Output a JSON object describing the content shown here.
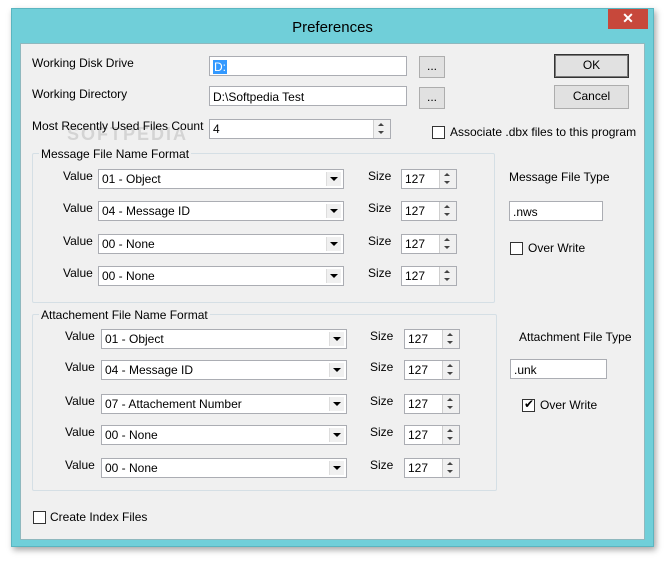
{
  "window": {
    "title": "Preferences",
    "close_glyph": "✕"
  },
  "top": {
    "working_disk_drive_label": "Working Disk Drive",
    "working_disk_drive_value": "D:",
    "working_directory_label": "Working Directory",
    "working_directory_value": "D:\\Softpedia Test",
    "browse_label": "...",
    "mru_label": "Most Recently Used Files Count",
    "mru_value": "4",
    "associate_label": "Associate .dbx files to this program",
    "associate_checked": false
  },
  "buttons": {
    "ok": "OK",
    "cancel": "Cancel"
  },
  "message_group": {
    "title": "Message File Name Format",
    "rows": [
      {
        "value_label": "Value",
        "value": "01 - Object",
        "size_label": "Size",
        "size": "127"
      },
      {
        "value_label": "Value",
        "value": "04 - Message ID",
        "size_label": "Size",
        "size": "127"
      },
      {
        "value_label": "Value",
        "value": "00 - None",
        "size_label": "Size",
        "size": "127"
      },
      {
        "value_label": "Value",
        "value": "00 - None",
        "size_label": "Size",
        "size": "127"
      }
    ]
  },
  "message_type": {
    "label": "Message File Type",
    "value": ".nws",
    "overwrite_label": "Over Write",
    "overwrite_checked": false
  },
  "attachment_group": {
    "title": "Attachement File Name Format",
    "rows": [
      {
        "value_label": "Value",
        "value": "01 - Object",
        "size_label": "Size",
        "size": "127"
      },
      {
        "value_label": "Value",
        "value": "04 - Message ID",
        "size_label": "Size",
        "size": "127"
      },
      {
        "value_label": "Value",
        "value": "07 - Attachement Number",
        "size_label": "Size",
        "size": "127"
      },
      {
        "value_label": "Value",
        "value": "00 - None",
        "size_label": "Size",
        "size": "127"
      },
      {
        "value_label": "Value",
        "value": "00 - None",
        "size_label": "Size",
        "size": "127"
      }
    ]
  },
  "attachment_type": {
    "label": "Attachment File Type",
    "value": ".unk",
    "overwrite_label": "Over Write",
    "overwrite_checked": true
  },
  "bottom": {
    "create_index_label": "Create Index Files",
    "create_index_checked": false
  },
  "watermark": "SOFTPEDIA"
}
